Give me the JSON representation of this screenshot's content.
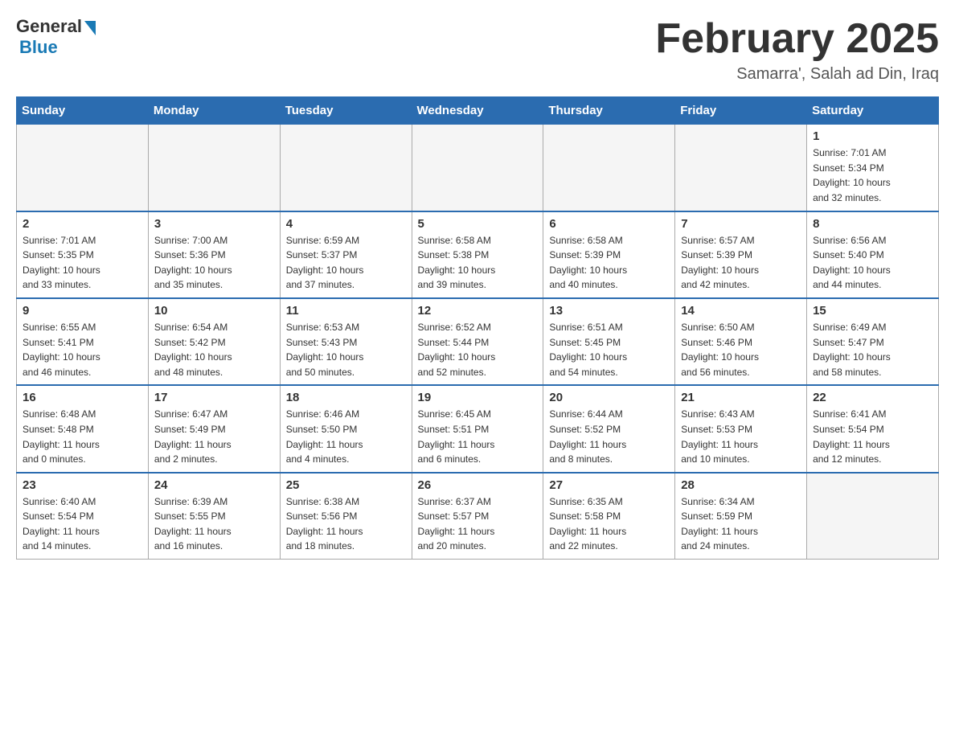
{
  "header": {
    "logo_general": "General",
    "logo_blue": "Blue",
    "month_title": "February 2025",
    "location": "Samarra', Salah ad Din, Iraq"
  },
  "days_of_week": [
    "Sunday",
    "Monday",
    "Tuesday",
    "Wednesday",
    "Thursday",
    "Friday",
    "Saturday"
  ],
  "weeks": [
    [
      {
        "day": "",
        "info": ""
      },
      {
        "day": "",
        "info": ""
      },
      {
        "day": "",
        "info": ""
      },
      {
        "day": "",
        "info": ""
      },
      {
        "day": "",
        "info": ""
      },
      {
        "day": "",
        "info": ""
      },
      {
        "day": "1",
        "info": "Sunrise: 7:01 AM\nSunset: 5:34 PM\nDaylight: 10 hours\nand 32 minutes."
      }
    ],
    [
      {
        "day": "2",
        "info": "Sunrise: 7:01 AM\nSunset: 5:35 PM\nDaylight: 10 hours\nand 33 minutes."
      },
      {
        "day": "3",
        "info": "Sunrise: 7:00 AM\nSunset: 5:36 PM\nDaylight: 10 hours\nand 35 minutes."
      },
      {
        "day": "4",
        "info": "Sunrise: 6:59 AM\nSunset: 5:37 PM\nDaylight: 10 hours\nand 37 minutes."
      },
      {
        "day": "5",
        "info": "Sunrise: 6:58 AM\nSunset: 5:38 PM\nDaylight: 10 hours\nand 39 minutes."
      },
      {
        "day": "6",
        "info": "Sunrise: 6:58 AM\nSunset: 5:39 PM\nDaylight: 10 hours\nand 40 minutes."
      },
      {
        "day": "7",
        "info": "Sunrise: 6:57 AM\nSunset: 5:39 PM\nDaylight: 10 hours\nand 42 minutes."
      },
      {
        "day": "8",
        "info": "Sunrise: 6:56 AM\nSunset: 5:40 PM\nDaylight: 10 hours\nand 44 minutes."
      }
    ],
    [
      {
        "day": "9",
        "info": "Sunrise: 6:55 AM\nSunset: 5:41 PM\nDaylight: 10 hours\nand 46 minutes."
      },
      {
        "day": "10",
        "info": "Sunrise: 6:54 AM\nSunset: 5:42 PM\nDaylight: 10 hours\nand 48 minutes."
      },
      {
        "day": "11",
        "info": "Sunrise: 6:53 AM\nSunset: 5:43 PM\nDaylight: 10 hours\nand 50 minutes."
      },
      {
        "day": "12",
        "info": "Sunrise: 6:52 AM\nSunset: 5:44 PM\nDaylight: 10 hours\nand 52 minutes."
      },
      {
        "day": "13",
        "info": "Sunrise: 6:51 AM\nSunset: 5:45 PM\nDaylight: 10 hours\nand 54 minutes."
      },
      {
        "day": "14",
        "info": "Sunrise: 6:50 AM\nSunset: 5:46 PM\nDaylight: 10 hours\nand 56 minutes."
      },
      {
        "day": "15",
        "info": "Sunrise: 6:49 AM\nSunset: 5:47 PM\nDaylight: 10 hours\nand 58 minutes."
      }
    ],
    [
      {
        "day": "16",
        "info": "Sunrise: 6:48 AM\nSunset: 5:48 PM\nDaylight: 11 hours\nand 0 minutes."
      },
      {
        "day": "17",
        "info": "Sunrise: 6:47 AM\nSunset: 5:49 PM\nDaylight: 11 hours\nand 2 minutes."
      },
      {
        "day": "18",
        "info": "Sunrise: 6:46 AM\nSunset: 5:50 PM\nDaylight: 11 hours\nand 4 minutes."
      },
      {
        "day": "19",
        "info": "Sunrise: 6:45 AM\nSunset: 5:51 PM\nDaylight: 11 hours\nand 6 minutes."
      },
      {
        "day": "20",
        "info": "Sunrise: 6:44 AM\nSunset: 5:52 PM\nDaylight: 11 hours\nand 8 minutes."
      },
      {
        "day": "21",
        "info": "Sunrise: 6:43 AM\nSunset: 5:53 PM\nDaylight: 11 hours\nand 10 minutes."
      },
      {
        "day": "22",
        "info": "Sunrise: 6:41 AM\nSunset: 5:54 PM\nDaylight: 11 hours\nand 12 minutes."
      }
    ],
    [
      {
        "day": "23",
        "info": "Sunrise: 6:40 AM\nSunset: 5:54 PM\nDaylight: 11 hours\nand 14 minutes."
      },
      {
        "day": "24",
        "info": "Sunrise: 6:39 AM\nSunset: 5:55 PM\nDaylight: 11 hours\nand 16 minutes."
      },
      {
        "day": "25",
        "info": "Sunrise: 6:38 AM\nSunset: 5:56 PM\nDaylight: 11 hours\nand 18 minutes."
      },
      {
        "day": "26",
        "info": "Sunrise: 6:37 AM\nSunset: 5:57 PM\nDaylight: 11 hours\nand 20 minutes."
      },
      {
        "day": "27",
        "info": "Sunrise: 6:35 AM\nSunset: 5:58 PM\nDaylight: 11 hours\nand 22 minutes."
      },
      {
        "day": "28",
        "info": "Sunrise: 6:34 AM\nSunset: 5:59 PM\nDaylight: 11 hours\nand 24 minutes."
      },
      {
        "day": "",
        "info": ""
      }
    ]
  ]
}
